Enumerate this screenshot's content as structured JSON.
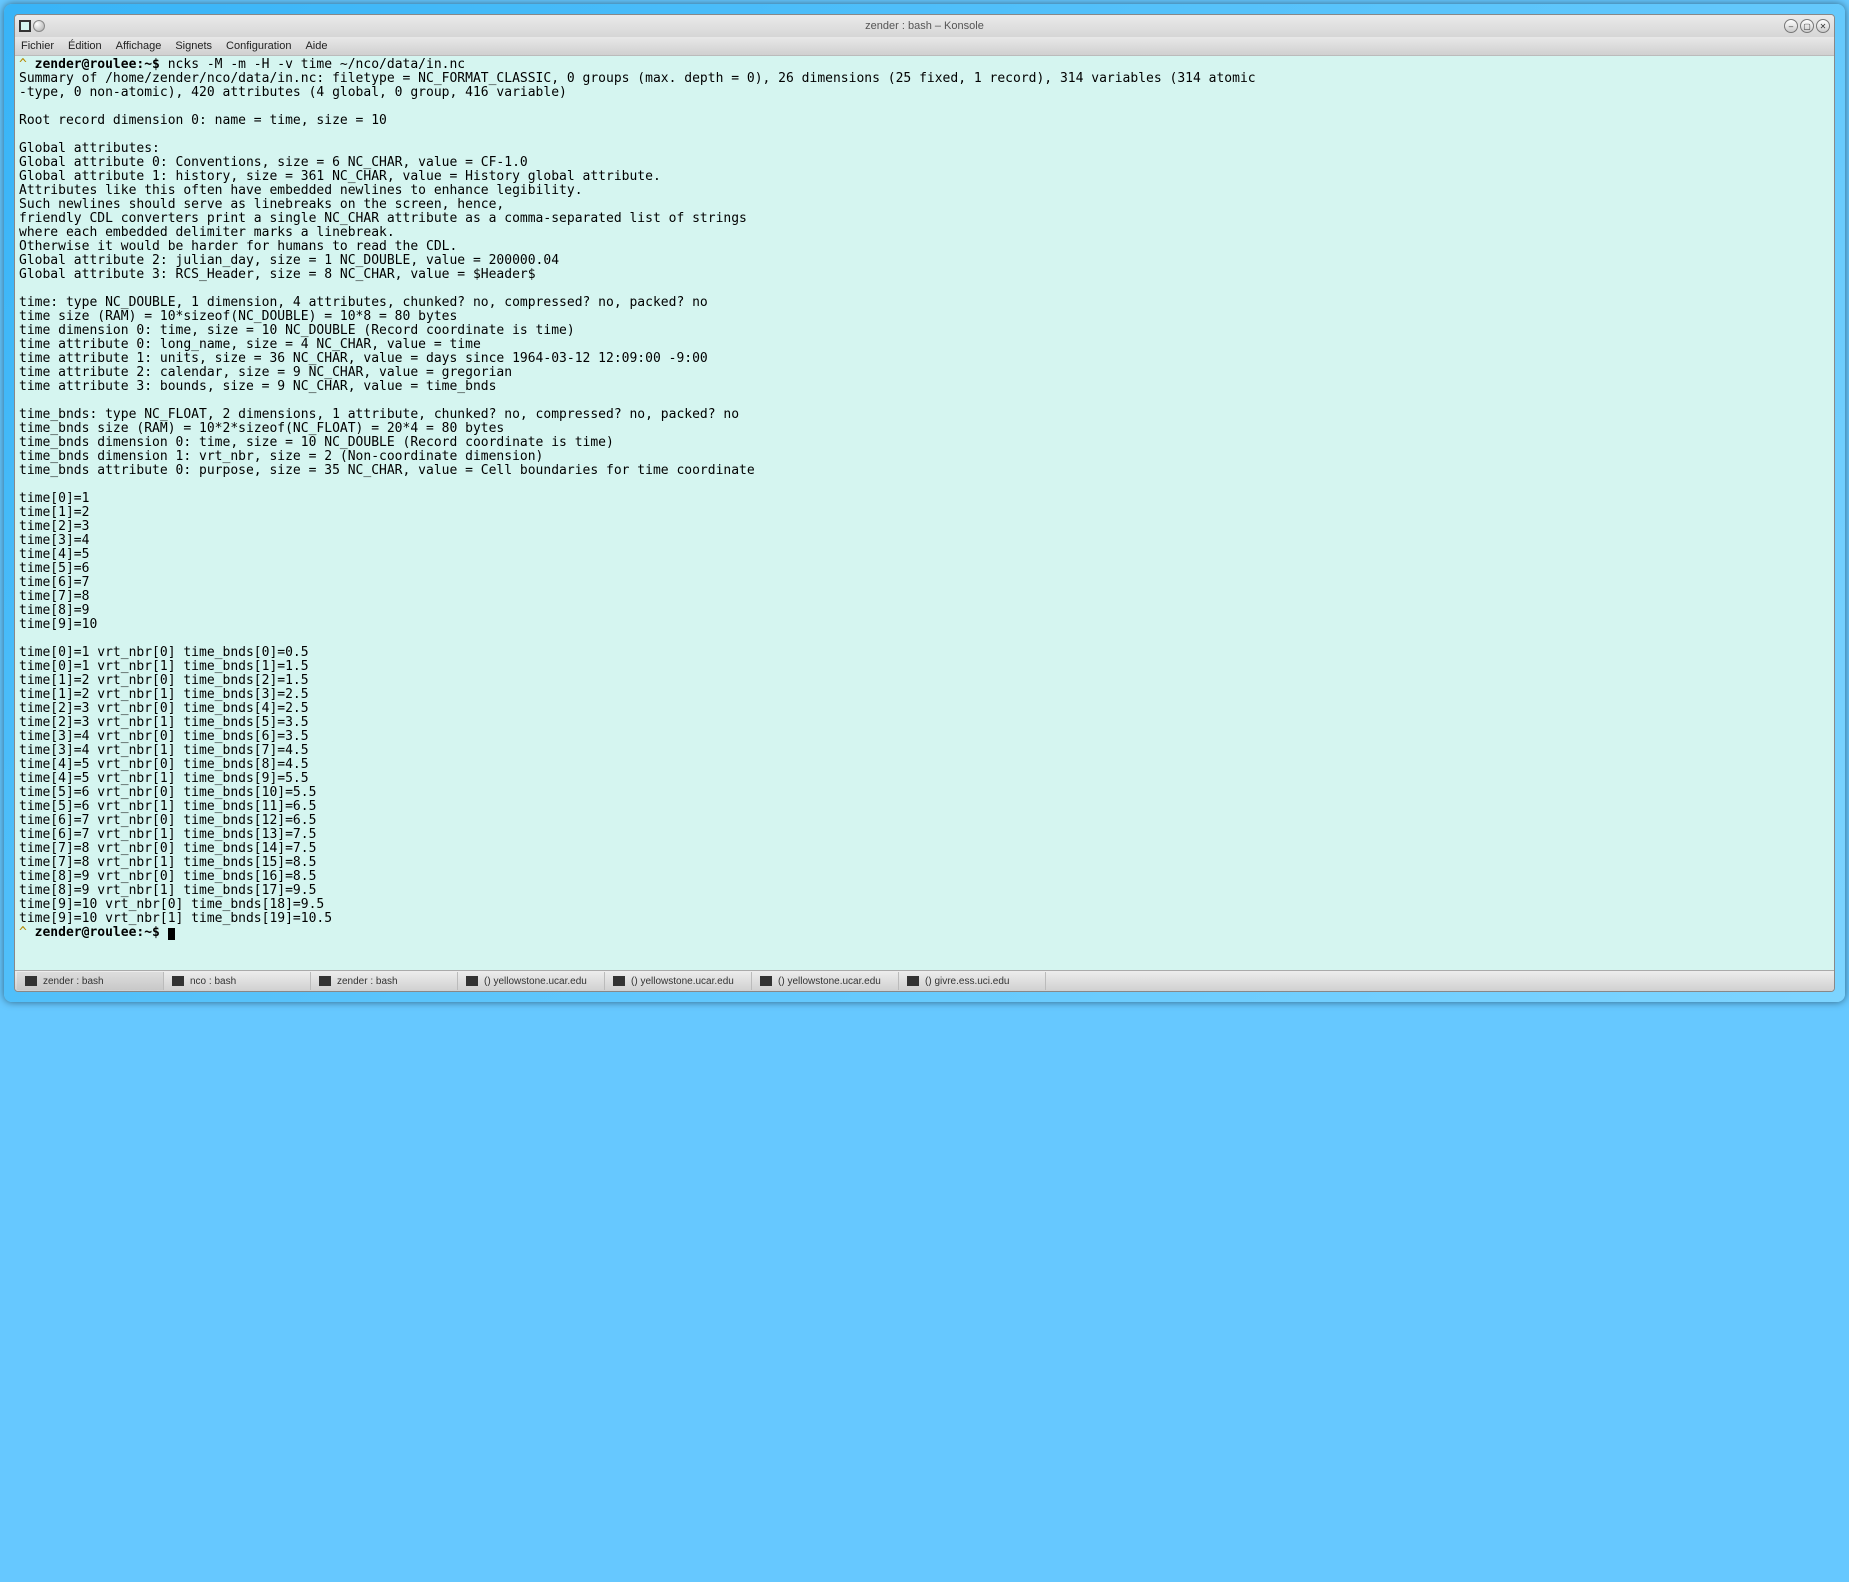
{
  "window": {
    "title": "zender : bash – Konsole"
  },
  "menu": {
    "items": [
      "Fichier",
      "Édition",
      "Affichage",
      "Signets",
      "Configuration",
      "Aide"
    ]
  },
  "terminal": {
    "prompt1": "zender@roulee:~$ ",
    "command": "ncks -M -m -H -v time ~/nco/data/in.nc",
    "output": "Summary of /home/zender/nco/data/in.nc: filetype = NC_FORMAT_CLASSIC, 0 groups (max. depth = 0), 26 dimensions (25 fixed, 1 record), 314 variables (314 atomic\n-type, 0 non-atomic), 420 attributes (4 global, 0 group, 416 variable)\n\nRoot record dimension 0: name = time, size = 10\n\nGlobal attributes:\nGlobal attribute 0: Conventions, size = 6 NC_CHAR, value = CF-1.0\nGlobal attribute 1: history, size = 361 NC_CHAR, value = History global attribute.\nAttributes like this often have embedded newlines to enhance legibility.\nSuch newlines should serve as linebreaks on the screen, hence,\nfriendly CDL converters print a single NC_CHAR attribute as a comma-separated list of strings\nwhere each embedded delimiter marks a linebreak.\nOtherwise it would be harder for humans to read the CDL.\nGlobal attribute 2: julian_day, size = 1 NC_DOUBLE, value = 200000.04\nGlobal attribute 3: RCS_Header, size = 8 NC_CHAR, value = $Header$\n\ntime: type NC_DOUBLE, 1 dimension, 4 attributes, chunked? no, compressed? no, packed? no\ntime size (RAM) = 10*sizeof(NC_DOUBLE) = 10*8 = 80 bytes\ntime dimension 0: time, size = 10 NC_DOUBLE (Record coordinate is time)\ntime attribute 0: long_name, size = 4 NC_CHAR, value = time\ntime attribute 1: units, size = 36 NC_CHAR, value = days since 1964-03-12 12:09:00 -9:00\ntime attribute 2: calendar, size = 9 NC_CHAR, value = gregorian\ntime attribute 3: bounds, size = 9 NC_CHAR, value = time_bnds\n\ntime_bnds: type NC_FLOAT, 2 dimensions, 1 attribute, chunked? no, compressed? no, packed? no\ntime_bnds size (RAM) = 10*2*sizeof(NC_FLOAT) = 20*4 = 80 bytes\ntime_bnds dimension 0: time, size = 10 NC_DOUBLE (Record coordinate is time)\ntime_bnds dimension 1: vrt_nbr, size = 2 (Non-coordinate dimension)\ntime_bnds attribute 0: purpose, size = 35 NC_CHAR, value = Cell boundaries for time coordinate\n\ntime[0]=1\ntime[1]=2\ntime[2]=3\ntime[3]=4\ntime[4]=5\ntime[5]=6\ntime[6]=7\ntime[7]=8\ntime[8]=9\ntime[9]=10\n\ntime[0]=1 vrt_nbr[0] time_bnds[0]=0.5\ntime[0]=1 vrt_nbr[1] time_bnds[1]=1.5\ntime[1]=2 vrt_nbr[0] time_bnds[2]=1.5\ntime[1]=2 vrt_nbr[1] time_bnds[3]=2.5\ntime[2]=3 vrt_nbr[0] time_bnds[4]=2.5\ntime[2]=3 vrt_nbr[1] time_bnds[5]=3.5\ntime[3]=4 vrt_nbr[0] time_bnds[6]=3.5\ntime[3]=4 vrt_nbr[1] time_bnds[7]=4.5\ntime[4]=5 vrt_nbr[0] time_bnds[8]=4.5\ntime[4]=5 vrt_nbr[1] time_bnds[9]=5.5\ntime[5]=6 vrt_nbr[0] time_bnds[10]=5.5\ntime[5]=6 vrt_nbr[1] time_bnds[11]=6.5\ntime[6]=7 vrt_nbr[0] time_bnds[12]=6.5\ntime[6]=7 vrt_nbr[1] time_bnds[13]=7.5\ntime[7]=8 vrt_nbr[0] time_bnds[14]=7.5\ntime[7]=8 vrt_nbr[1] time_bnds[15]=8.5\ntime[8]=9 vrt_nbr[0] time_bnds[16]=8.5\ntime[8]=9 vrt_nbr[1] time_bnds[17]=9.5\ntime[9]=10 vrt_nbr[0] time_bnds[18]=9.5\ntime[9]=10 vrt_nbr[1] time_bnds[19]=10.5",
    "prompt2": "zender@roulee:~$ "
  },
  "taskbar": {
    "items": [
      {
        "label": "zender : bash",
        "active": true
      },
      {
        "label": "nco : bash",
        "active": false
      },
      {
        "label": "zender : bash",
        "active": false
      },
      {
        "label": "() yellowstone.ucar.edu",
        "active": false
      },
      {
        "label": "() yellowstone.ucar.edu",
        "active": false
      },
      {
        "label": "() yellowstone.ucar.edu",
        "active": false
      },
      {
        "label": "() givre.ess.uci.edu",
        "active": false
      }
    ]
  },
  "icons": {
    "minimize": "–",
    "maximize": "▢",
    "close": "✕"
  }
}
